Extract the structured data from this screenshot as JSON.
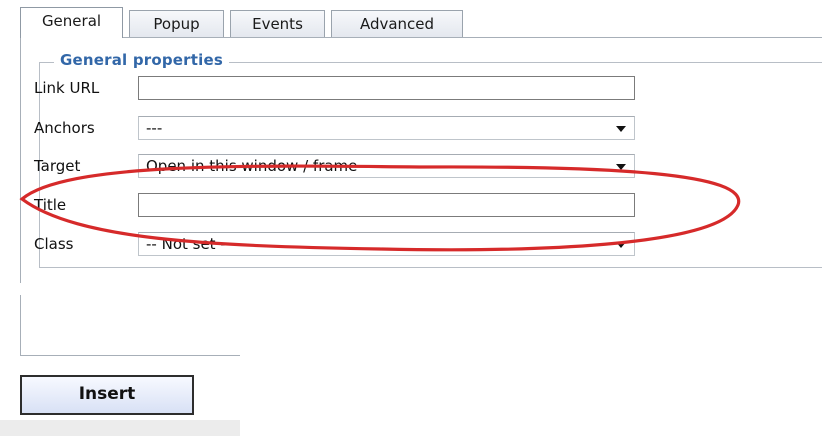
{
  "tabs": [
    {
      "label": "General",
      "active": true
    },
    {
      "label": "Popup",
      "active": false
    },
    {
      "label": "Events",
      "active": false
    },
    {
      "label": "Advanced",
      "active": false
    }
  ],
  "general": {
    "legend": "General properties",
    "fields": {
      "link_url": {
        "label": "Link URL",
        "value": "",
        "placeholder": ""
      },
      "anchors": {
        "label": "Anchors",
        "value": "---"
      },
      "target": {
        "label": "Target",
        "value": "Open in this window / frame"
      },
      "title": {
        "label": "Title",
        "value": "",
        "placeholder": ""
      },
      "class": {
        "label": "Class",
        "value": "-- Not set --"
      }
    }
  },
  "actions": {
    "insert_label": "Insert"
  },
  "annotation": {
    "color": "#d62a2a",
    "highlight": "Title row"
  },
  "icons": {
    "dropdown": "chevron-down-icon"
  }
}
